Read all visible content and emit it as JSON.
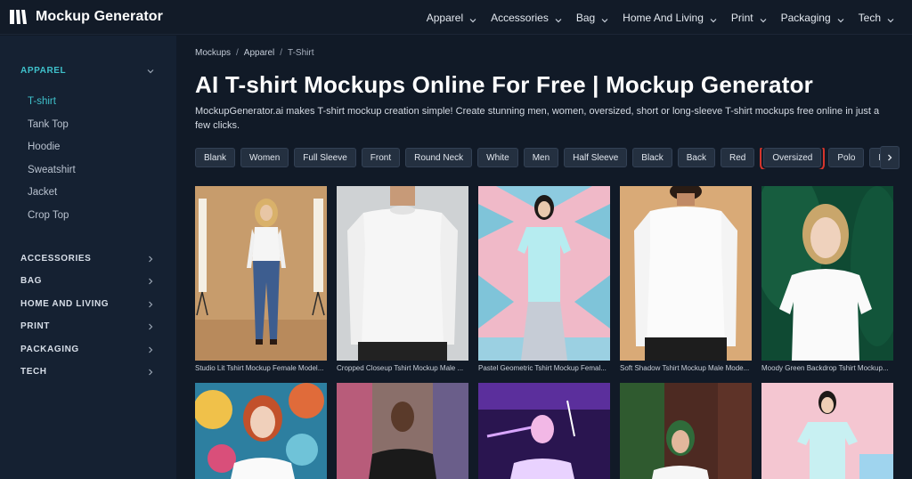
{
  "app": {
    "name": "Mockup Generator",
    "logo_icon": "logo-stripes-icon"
  },
  "topnav": {
    "items": [
      {
        "label": "Apparel"
      },
      {
        "label": "Accessories"
      },
      {
        "label": "Bag"
      },
      {
        "label": "Home And Living"
      },
      {
        "label": "Print"
      },
      {
        "label": "Packaging"
      },
      {
        "label": "Tech"
      }
    ]
  },
  "sidebar": {
    "active_section": "APPAREL",
    "sections": [
      {
        "label": "APPAREL",
        "expanded": true
      },
      {
        "label": "ACCESSORIES"
      },
      {
        "label": "BAG"
      },
      {
        "label": "HOME AND LIVING"
      },
      {
        "label": "PRINT"
      },
      {
        "label": "PACKAGING"
      },
      {
        "label": "TECH"
      }
    ],
    "subitems": [
      {
        "label": "T-shirt",
        "active": true
      },
      {
        "label": "Tank Top"
      },
      {
        "label": "Hoodie"
      },
      {
        "label": "Sweatshirt"
      },
      {
        "label": "Jacket"
      },
      {
        "label": "Crop Top"
      }
    ]
  },
  "breadcrumb": {
    "items": [
      "Mockups",
      "Apparel",
      "T-Shirt"
    ],
    "separator": "/"
  },
  "page": {
    "title": "AI T-shirt Mockups Online For Free | Mockup Generator",
    "description": "MockupGenerator.ai makes T-shirt mockup creation simple! Create stunning men, women, oversized, short or long-sleeve T-shirt mockups free online in just a few clicks."
  },
  "filters": {
    "chips": [
      "Blank",
      "Women",
      "Full Sleeve",
      "Front",
      "Round Neck",
      "White",
      "Men",
      "Half Sleeve",
      "Black",
      "Back",
      "Red",
      "Oversized",
      "Polo",
      "Mannequin"
    ],
    "highlighted": "Oversized"
  },
  "grid": {
    "row1": [
      {
        "caption": "Studio Lit Tshirt Mockup Female Model..."
      },
      {
        "caption": "Cropped Closeup Tshirt Mockup Male ..."
      },
      {
        "caption": "Pastel Geometric Tshirt Mockup Femal..."
      },
      {
        "caption": "Soft Shadow Tshirt Mockup Male Mode..."
      },
      {
        "caption": "Moody Green Backdrop Tshirt Mockup..."
      }
    ]
  },
  "colors": {
    "accent": "#3fc1cb",
    "highlight_outline": "#d5352c",
    "background": "#111a27",
    "sidebar": "#152132"
  }
}
